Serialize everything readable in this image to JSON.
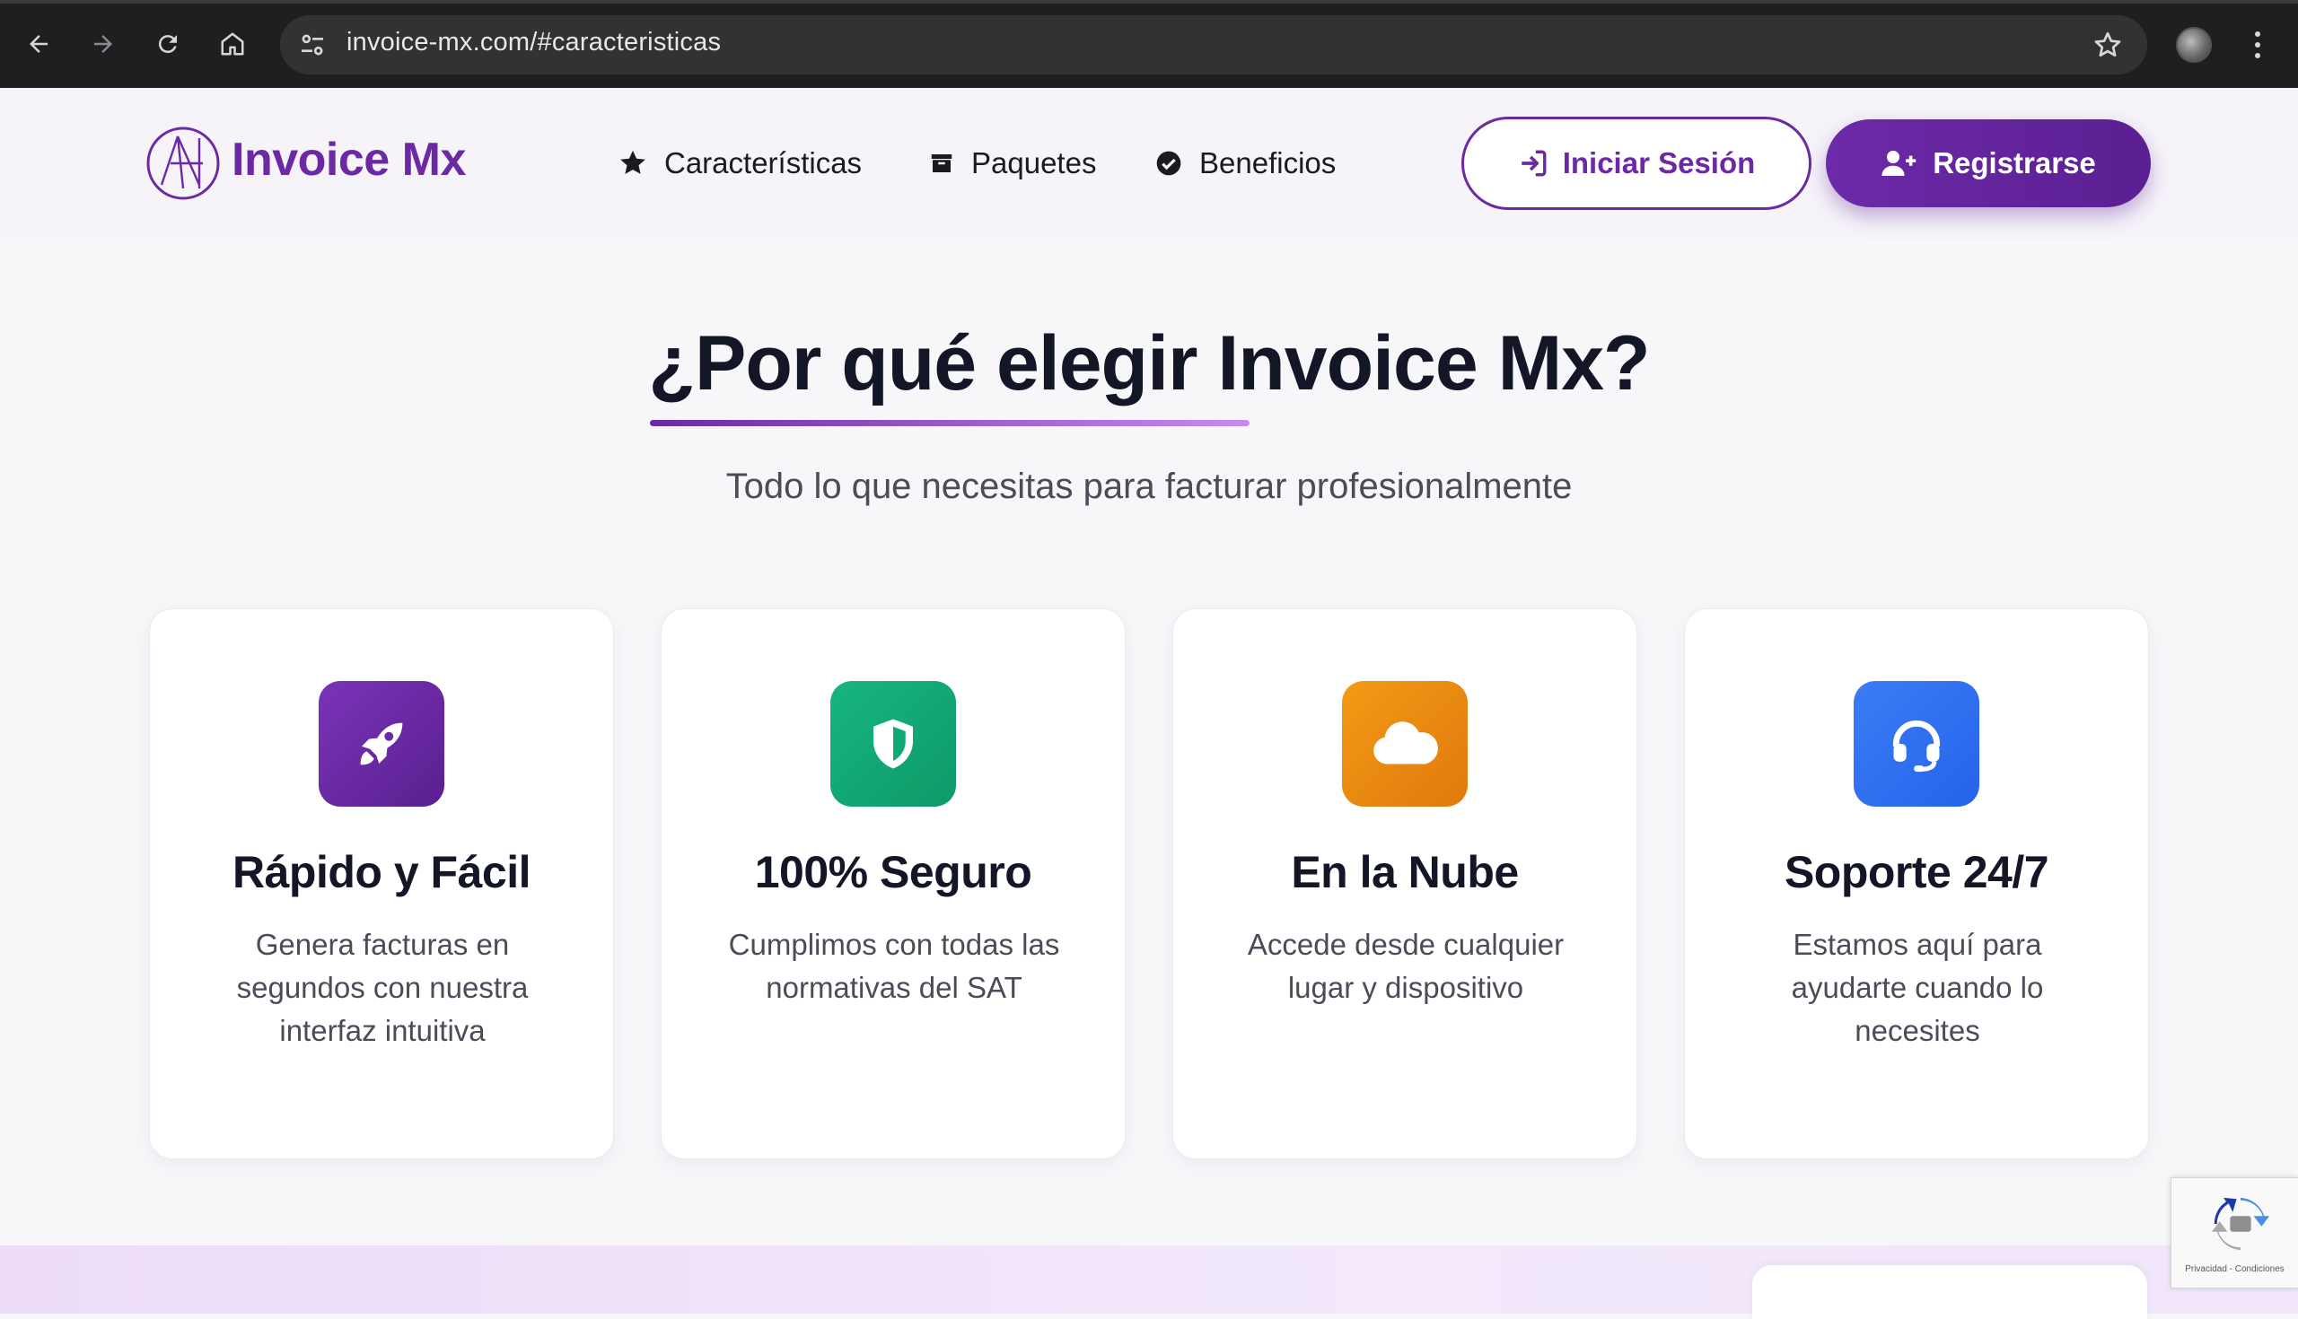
{
  "browser": {
    "url": "invoice-mx.com/#caracteristicas",
    "back_icon": "arrow-left-icon",
    "forward_icon": "arrow-right-icon",
    "reload_icon": "reload-icon",
    "home_icon": "home-icon",
    "bookmark_icon": "star-outline-icon",
    "menu_icon": "kebab-menu-icon"
  },
  "header": {
    "logo_text": "Invoice Mx",
    "nav": [
      {
        "label": "Características",
        "icon": "star-icon"
      },
      {
        "label": "Paquetes",
        "icon": "box-icon"
      },
      {
        "label": "Beneficios",
        "icon": "check-circle-icon"
      }
    ],
    "login_label": "Iniciar Sesión",
    "register_label": "Registrarse",
    "brand_color": "#6b2aa3"
  },
  "section": {
    "title": "¿Por qué elegir Invoice Mx?",
    "subtitle": "Todo lo que necesitas para facturar profesionalmente"
  },
  "features": [
    {
      "icon": "rocket-icon",
      "title": "Rápido y Fácil",
      "text": "Genera facturas en segundos con nuestra interfaz intuitiva",
      "color": "#6b2aa3"
    },
    {
      "icon": "shield-icon",
      "title": "100% Seguro",
      "text": "Cumplimos con todas las normativas del SAT",
      "color": "#10a873"
    },
    {
      "icon": "cloud-icon",
      "title": "En la Nube",
      "text": "Accede desde cualquier lugar y dispositivo",
      "color": "#ee8a10"
    },
    {
      "icon": "headset-icon",
      "title": "Soporte 24/7",
      "text": "Estamos aquí para ayudarte cuando lo necesites",
      "color": "#2f6ff0"
    }
  ],
  "recaptcha": {
    "text": "Privacidad - Condiciones"
  }
}
